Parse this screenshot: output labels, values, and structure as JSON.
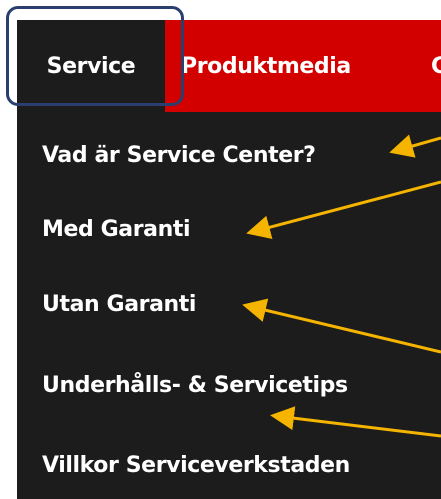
{
  "nav": {
    "tabs": [
      {
        "label": "Service",
        "active": true
      },
      {
        "label": "Produktmedia",
        "active": false
      },
      {
        "label": "C",
        "active": false
      }
    ]
  },
  "dropdown": {
    "items": [
      {
        "label": "Vad är Service Center?"
      },
      {
        "label": "Med Garanti"
      },
      {
        "label": "Utan Garanti"
      },
      {
        "label": "Underhålls- & Servicetips"
      },
      {
        "label": "Villkor Serviceverkstaden"
      }
    ]
  },
  "colors": {
    "nav_background": "#d30000",
    "active_tab_background": "#1c1c1c",
    "dropdown_background": "#1c1c1c",
    "text": "#ffffff",
    "annotation_arrow": "#f5b400",
    "highlight_border": "#2b3f6e"
  }
}
